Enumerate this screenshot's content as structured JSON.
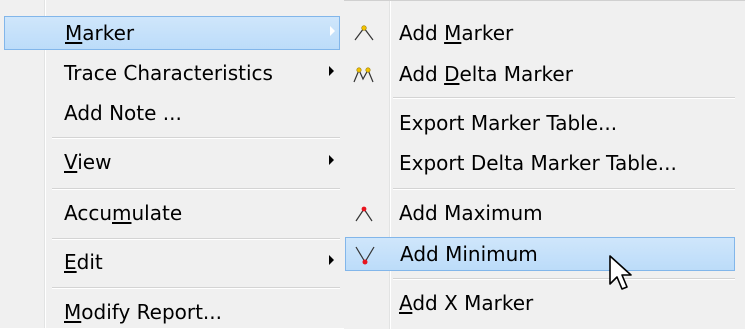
{
  "main_menu": {
    "items": [
      {
        "pre": "",
        "key": "M",
        "post": "arker",
        "submenu": true,
        "highlighted": true
      },
      {
        "pre": "Trace Characteristics",
        "key": "",
        "post": "",
        "submenu": true
      },
      {
        "pre": "Add Note ...",
        "key": "",
        "post": "",
        "submenu": false
      },
      {
        "pre": "",
        "key": "V",
        "post": "iew",
        "submenu": true
      },
      {
        "pre": "Accu",
        "key": "m",
        "post": "ulate",
        "submenu": false
      },
      {
        "pre": "",
        "key": "E",
        "post": "dit",
        "submenu": true
      },
      {
        "pre": "",
        "key": "M",
        "post": "odify Report...",
        "submenu": false
      }
    ]
  },
  "sub_menu": {
    "items": [
      {
        "pre": "Add ",
        "key": "M",
        "post": "arker",
        "icon": "marker-peak-icon"
      },
      {
        "pre": "Add ",
        "key": "D",
        "post": "elta Marker",
        "icon": "delta-marker-icon"
      },
      {
        "pre": "Export Marker Table...",
        "key": "",
        "post": "",
        "icon": ""
      },
      {
        "pre": "Export Delta Marker Table...",
        "key": "",
        "post": "",
        "icon": ""
      },
      {
        "pre": "Add Maximum",
        "key": "",
        "post": "",
        "icon": "maximum-icon"
      },
      {
        "pre": "Add Minimum",
        "key": "",
        "post": "",
        "icon": "minimum-icon",
        "highlighted": true
      },
      {
        "pre": "",
        "key": "A",
        "post": "dd X Marker",
        "icon": ""
      }
    ]
  },
  "colors": {
    "menu_bg": "#f0f0f0",
    "highlight_bg": "#c6e1fa",
    "highlight_border": "#82b6ea",
    "marker_red": "#e8141e"
  }
}
